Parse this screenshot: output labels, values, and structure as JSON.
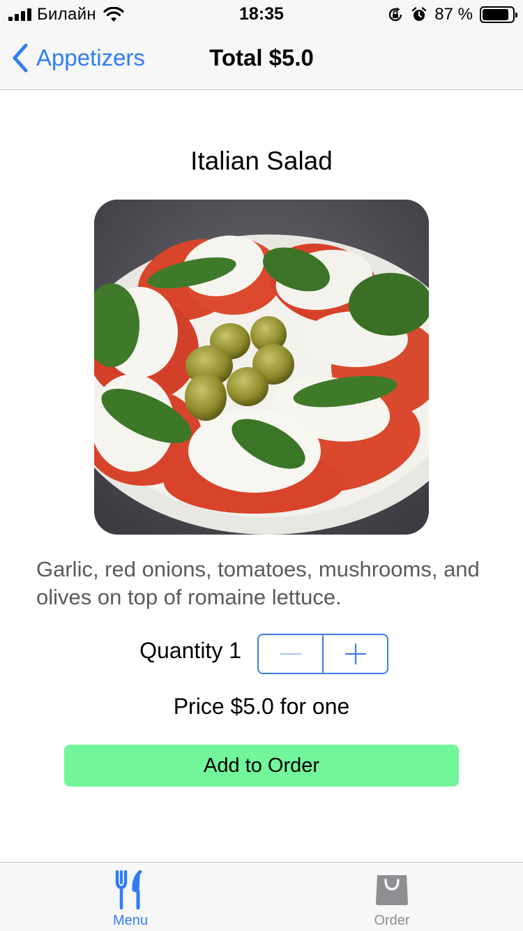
{
  "status_bar": {
    "carrier": "Билайн",
    "time": "18:35",
    "battery_text": "87 %",
    "battery_level": 0.87,
    "icons": [
      "signal-icon",
      "wifi-icon",
      "orientation-lock-icon",
      "alarm-icon",
      "battery-icon"
    ]
  },
  "nav": {
    "back_label": "Appetizers",
    "title": "Total $5.0"
  },
  "item": {
    "title": "Italian Salad",
    "description": "Garlic, red onions, tomatoes, mushrooms, and olives on top of romaine lettuce.",
    "quantity_label": "Quantity 1",
    "price_label": "Price $5.0 for one"
  },
  "actions": {
    "add_to_order": "Add to Order"
  },
  "tabs": [
    {
      "label": "Menu",
      "icon": "fork-knife-icon",
      "selected": true
    },
    {
      "label": "Order",
      "icon": "bag-icon",
      "selected": false
    }
  ],
  "colors": {
    "accent": "#2f7cf6",
    "stepper_border": "#3b7ee1",
    "add_button": "#72f59b",
    "inactive_tab": "#8e8e93"
  }
}
